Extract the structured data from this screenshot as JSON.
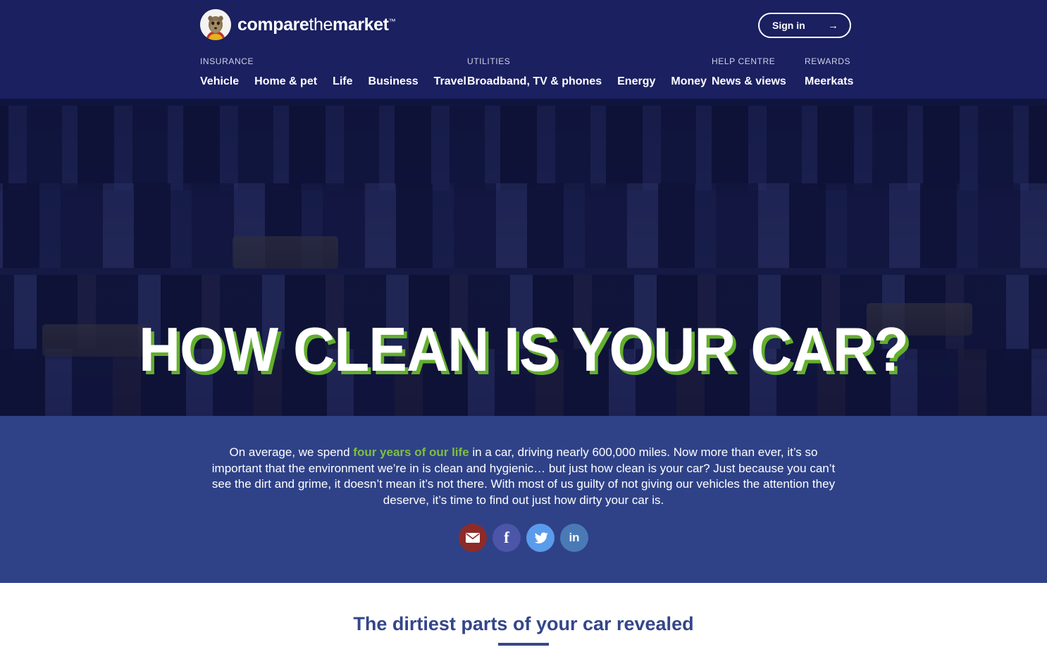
{
  "header": {
    "logo": {
      "icon": "meerkat-avatar-icon",
      "word_compare": "compare",
      "word_the": "the",
      "word_market": "market",
      "trademark": "™"
    },
    "sign_in": {
      "label": "Sign in",
      "arrow": "→"
    },
    "nav_groups": [
      {
        "category": "INSURANCE",
        "items": [
          "Vehicle",
          "Home & pet",
          "Life",
          "Business",
          "Travel"
        ]
      },
      {
        "category": "UTILITIES",
        "items": [
          "Broadband, TV & phones",
          "Energy",
          "Money"
        ]
      },
      {
        "category": "HELP CENTRE",
        "items": [
          "News & views"
        ]
      },
      {
        "category": "REWARDS",
        "items": [
          "Meerkats"
        ]
      }
    ]
  },
  "hero": {
    "title": "HOW CLEAN IS YOUR CAR?",
    "title_shadow_color": "#63af2e",
    "overlay_color": "#1a2060"
  },
  "intro": {
    "background_color": "#2f4288",
    "text_before": "On average, we spend ",
    "highlight": "four years of our life",
    "highlight_color": "#7fbf3f",
    "text_after": " in a car, driving nearly 600,000 miles. Now more than ever, it’s so important that the environment we’re in is clean and hygienic… but just how clean is your car? Just because you can’t see the dirt and grime, it doesn’t mean it’s not there. With most of us guilty of not giving our vehicles the attention they deserve, it’s time to find out just how dirty your car is.",
    "share_buttons": [
      {
        "name": "email-share-button",
        "glyph": "✉",
        "color": "#8e2b28"
      },
      {
        "name": "facebook-share-button",
        "glyph": "f",
        "color": "#4b56a8"
      },
      {
        "name": "twitter-share-button",
        "glyph": "ᴠ",
        "color": "#5b9bec"
      },
      {
        "name": "linkedin-share-button",
        "glyph": "in",
        "color": "#4a7ab5"
      }
    ]
  },
  "section": {
    "title": "The dirtiest parts of your car revealed",
    "title_color": "#34468a"
  }
}
